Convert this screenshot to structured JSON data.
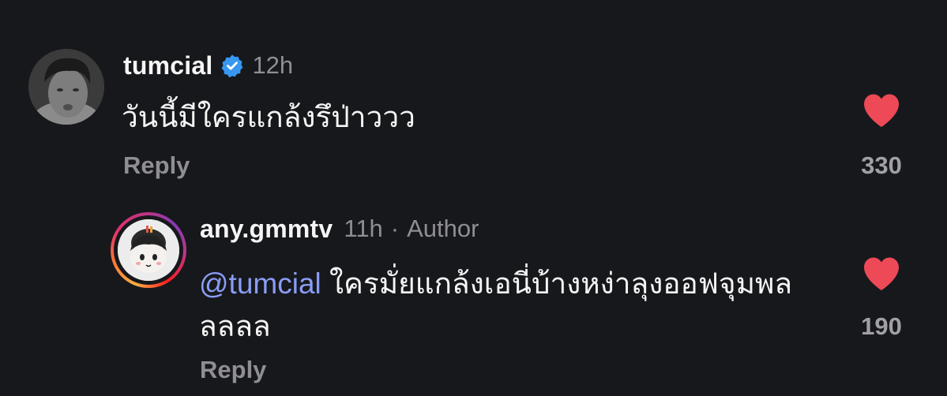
{
  "comments": [
    {
      "username": "tumcial",
      "verified_icon": "verified-badge-icon",
      "time": "12h",
      "text": "วันนี้มีใครแกล้งรึป่าววว",
      "reply_label": "Reply",
      "like_count": "330",
      "heart_color": "#ed4956"
    },
    {
      "username": "any.gmmtv",
      "time": "11h",
      "separator": "·",
      "role": "Author",
      "mention": "@tumcial",
      "text": "ใครมั่ยแกล้งเอนี่บ้างหง่าลุงออฟจุมพลลลลล",
      "reply_label": "Reply",
      "like_count": "190",
      "heart_color": "#ed4956"
    }
  ],
  "colors": {
    "background": "#17181c",
    "text_primary": "#f5f5f5",
    "text_secondary": "#8e8e93",
    "mention": "#8a9cf5",
    "verified": "#3897f0",
    "like": "#ed4956"
  }
}
